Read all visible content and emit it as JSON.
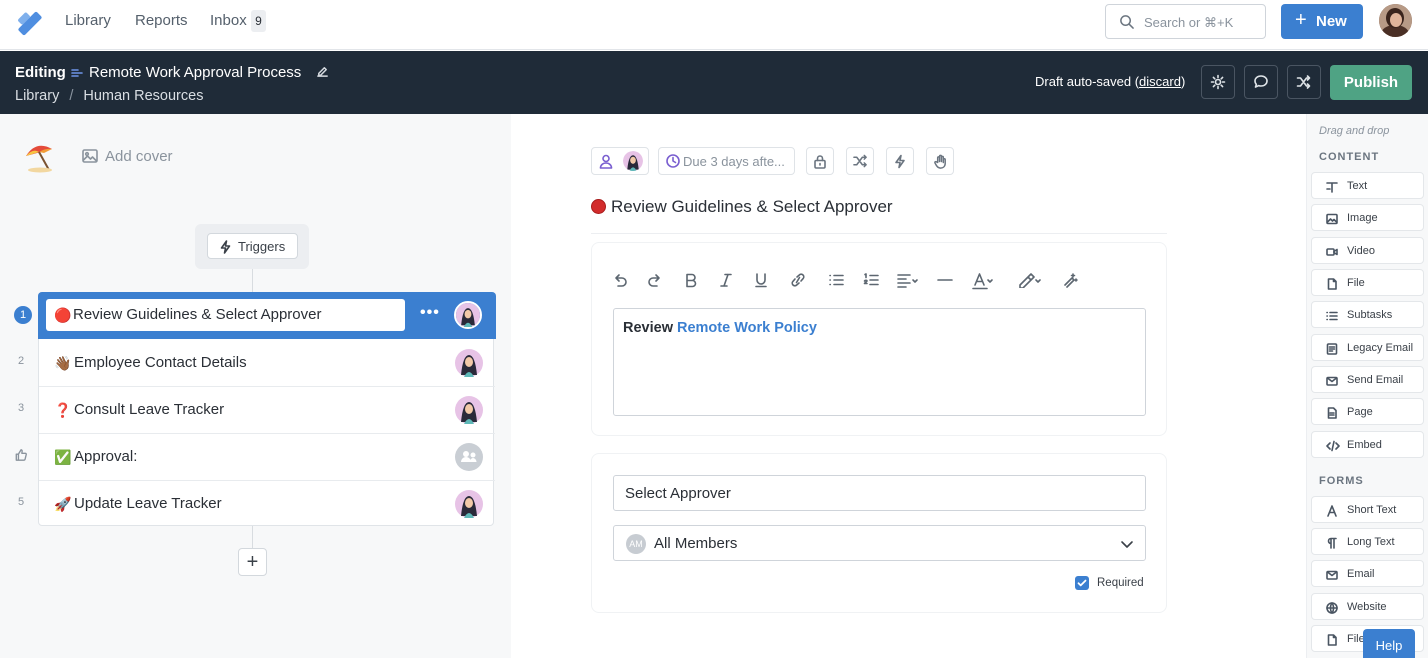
{
  "nav": {
    "links": [
      "Library",
      "Reports",
      "Inbox"
    ],
    "inbox_count": "9",
    "search_placeholder": "Search or ⌘+K",
    "new_label": "New"
  },
  "editbar": {
    "mode": "Editing",
    "title": "Remote Work Approval Process",
    "breadcrumb": [
      "Library",
      "Human Resources"
    ],
    "draft_text": "Draft auto-saved (",
    "discard": "discard",
    "draft_close": ")",
    "publish": "Publish"
  },
  "left": {
    "add_cover": "Add cover",
    "triggers": "Triggers",
    "tasks": [
      {
        "num": "1",
        "emoji": "🔴",
        "title": "Review Guidelines & Select Approver",
        "selected": true
      },
      {
        "num": "2",
        "emoji": "👋🏾",
        "title": "Employee Contact Details"
      },
      {
        "num": "3",
        "emoji": "❓",
        "title": "Consult Leave Tracker"
      },
      {
        "num": "",
        "emoji": "✅",
        "title": "Approval:"
      },
      {
        "num": "5",
        "emoji": "🚀",
        "title": "Update Leave Tracker"
      }
    ],
    "add_step": "+"
  },
  "center": {
    "due": "Due 3 days afte...",
    "step_title": "Review Guidelines & Select Approver",
    "rte_bold": "Review ",
    "rte_link": "Remote Work Policy",
    "approver_label": "Select Approver",
    "members_initials": "AM",
    "members_value": "All Members",
    "required_label": "Required"
  },
  "sidebar": {
    "drag_drop": "Drag and drop",
    "content_title": "CONTENT",
    "content_items": [
      {
        "label": "Text",
        "icon": "text-icon"
      },
      {
        "label": "Image",
        "icon": "image-icon"
      },
      {
        "label": "Video",
        "icon": "video-icon"
      },
      {
        "label": "File",
        "icon": "file-icon"
      },
      {
        "label": "Subtasks",
        "icon": "list-icon"
      },
      {
        "label": "Legacy Email",
        "icon": "legacy-email-icon"
      },
      {
        "label": "Send Email",
        "icon": "email-icon"
      },
      {
        "label": "Page",
        "icon": "page-icon"
      },
      {
        "label": "Embed",
        "icon": "code-icon"
      }
    ],
    "forms_title": "FORMS",
    "form_items": [
      {
        "label": "Short Text",
        "icon": "short-text-icon"
      },
      {
        "label": "Long Text",
        "icon": "long-text-icon"
      },
      {
        "label": "Email",
        "icon": "email-icon"
      },
      {
        "label": "Website",
        "icon": "globe-icon"
      },
      {
        "label": "File",
        "icon": "file-icon"
      }
    ]
  },
  "help": "Help",
  "colors": {
    "primary": "#3b7fd0",
    "publish": "#4fa384",
    "dark_bar": "#1f2b38"
  }
}
